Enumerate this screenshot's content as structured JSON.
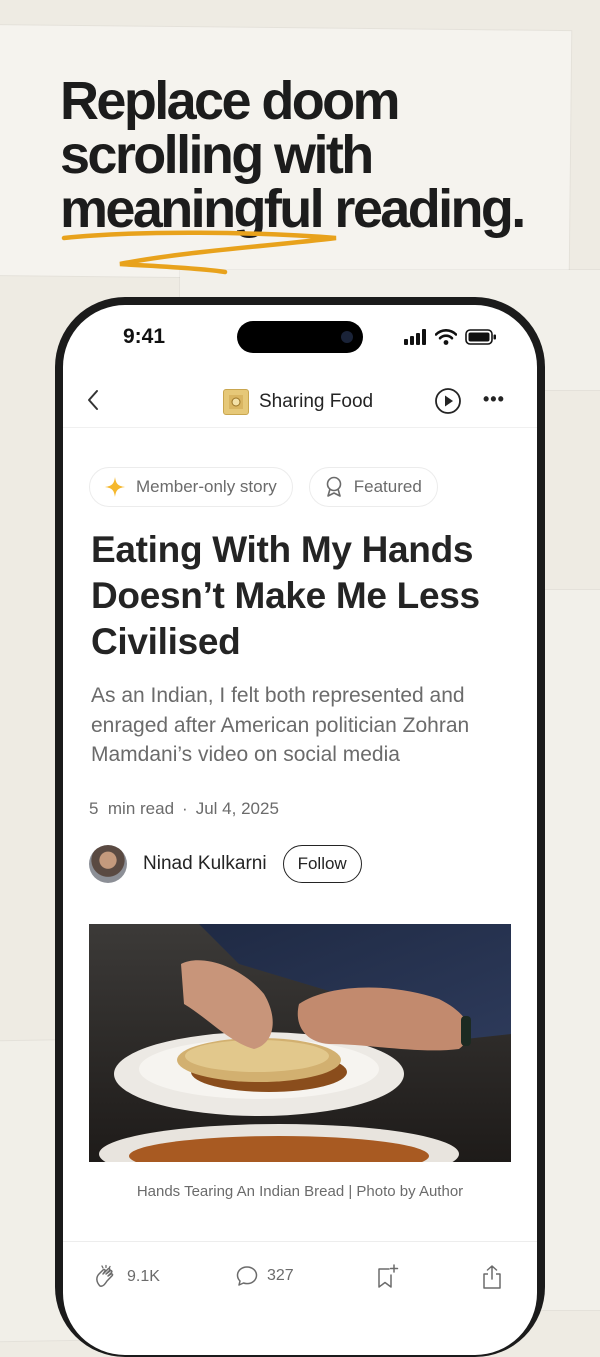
{
  "promo": {
    "headline_lines": [
      "Replace doom",
      "scrolling with",
      "meaningful reading."
    ]
  },
  "status_bar": {
    "time": "9:41"
  },
  "header": {
    "publication": "Sharing Food",
    "logo_text": "Sharing Food"
  },
  "badges": {
    "member": "Member-only story",
    "featured": "Featured"
  },
  "article": {
    "title": "Eating With My Hands Doesn’t Make Me Less Civilised",
    "subtitle": "As an Indian, I felt both represented and enraged after American politician Zohran Mamdani’s video on social media",
    "read_time": "5  min read",
    "date": "Jul 4, 2025",
    "author": "Ninad Kulkarni",
    "follow_label": "Follow",
    "image_caption": "Hands Tearing An Indian Bread | Photo by Author"
  },
  "actions": {
    "claps": "9.1K",
    "responses": "327"
  },
  "colors": {
    "background": "#eeebe3",
    "accent_underline": "#e8a21c",
    "star": "#f5b82e",
    "text": "#242424",
    "muted": "#6b6b6b"
  },
  "icons": [
    "back-chevron-icon",
    "play-icon",
    "more-icon",
    "sparkle-star-icon",
    "award-ribbon-icon",
    "clap-icon",
    "comment-icon",
    "bookmark-add-icon",
    "share-icon",
    "signal-icon",
    "wifi-icon",
    "battery-icon"
  ]
}
